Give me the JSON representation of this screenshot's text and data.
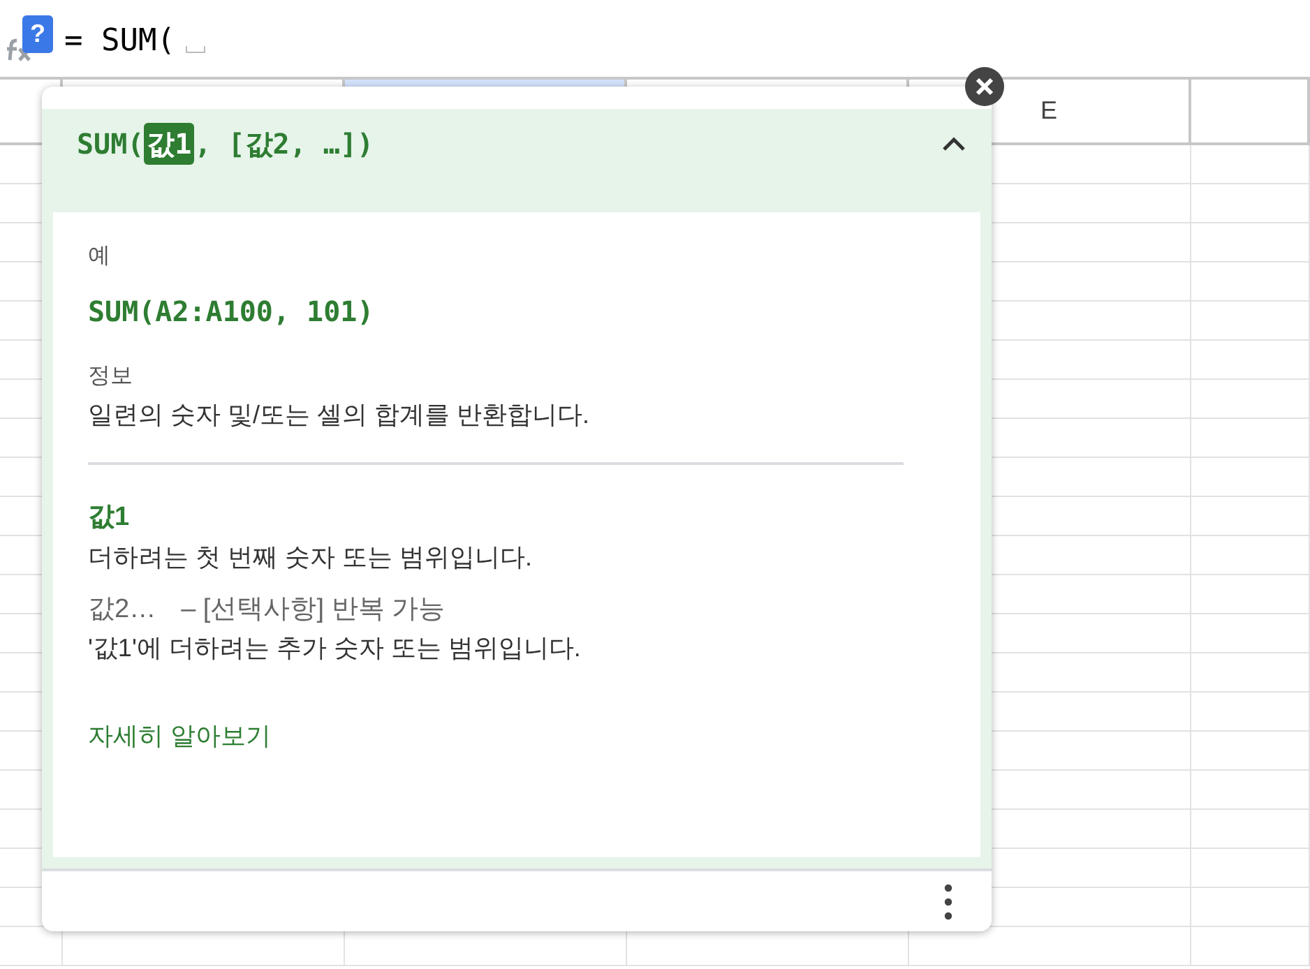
{
  "formula_bar": {
    "help_badge": "?",
    "formula": "= SUM("
  },
  "column_header": "E",
  "popup": {
    "expanded": true,
    "signature": {
      "open": "SUM(",
      "separator": ",",
      "close": ")",
      "params": [
        {
          "text": "값1",
          "selected": true
        },
        {
          "text": "[값2, …]",
          "selected": false
        }
      ]
    },
    "example_label": "예",
    "example": "SUM(A2:A100, 101)",
    "info_label": "정보",
    "info": "일련의 숫자 및/또는 셀의 합계를 반환합니다.",
    "arguments": [
      {
        "name": "값1",
        "selected": true,
        "description": "더하려는 첫 번째 숫자 또는 범위입니다."
      },
      {
        "name": "값2…",
        "note": "– [선택사항] 반복 가능",
        "selected": false,
        "description": "'값1'에 더하려는 추가 숫자 또는 범위입니다."
      }
    ],
    "learn_more": "자세히 알아보기"
  }
}
